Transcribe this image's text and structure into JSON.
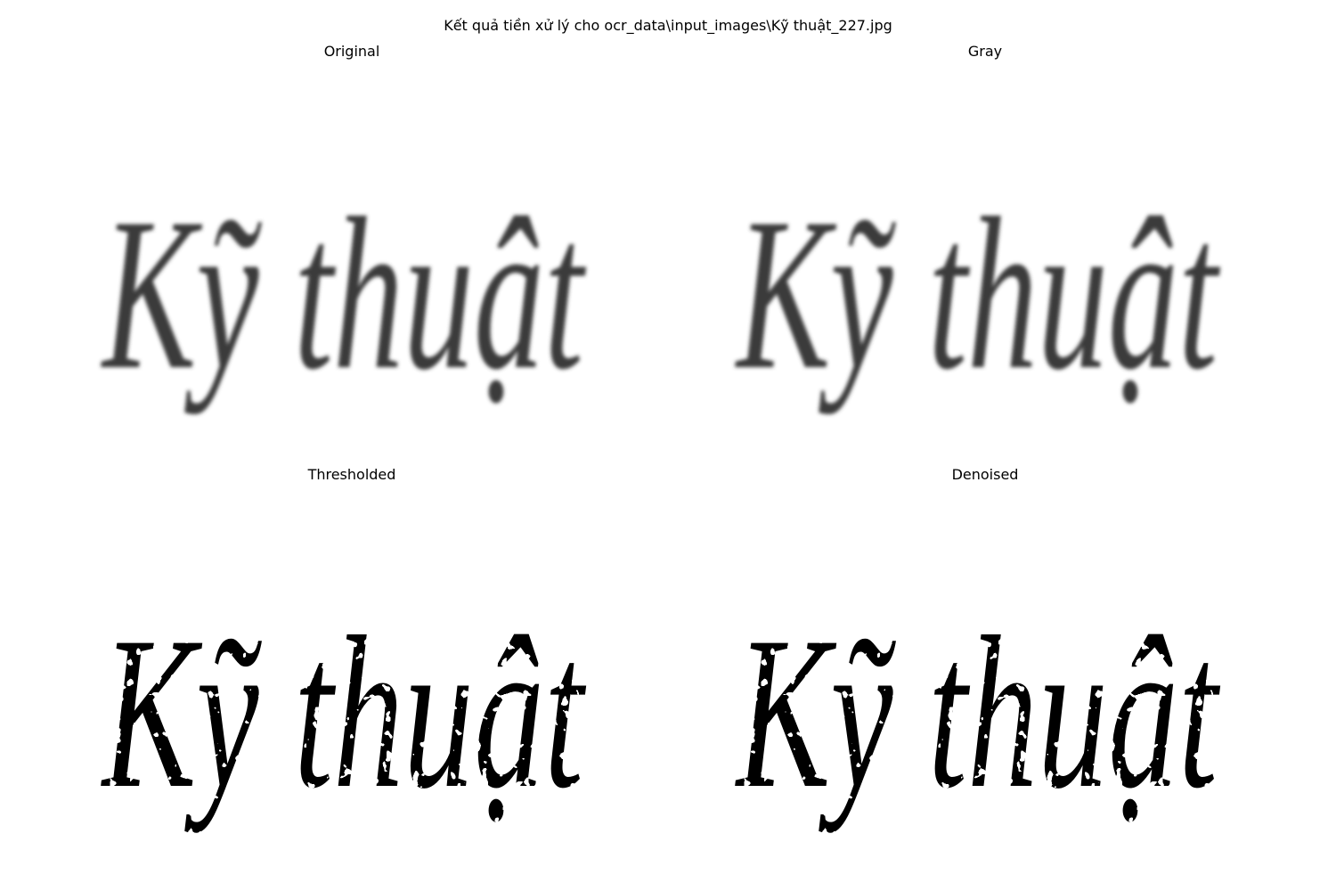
{
  "figure": {
    "suptitle": "Kết quả tiền xử lý cho ocr_data\\input_images\\Kỹ thuật_227.jpg"
  },
  "panels": [
    {
      "title": "Original",
      "text": "Kỹ thuật",
      "style": "blurred-gray"
    },
    {
      "title": "Gray",
      "text": "Kỹ thuật",
      "style": "blurred-gray"
    },
    {
      "title": "Thresholded",
      "text": "Kỹ thuật",
      "style": "binary-fragmented"
    },
    {
      "title": "Denoised",
      "text": "Kỹ thuật",
      "style": "binary-fragmented"
    }
  ],
  "colors": {
    "background": "#ffffff",
    "ink": "#000000",
    "gray_ink": "#3a3a3a"
  }
}
